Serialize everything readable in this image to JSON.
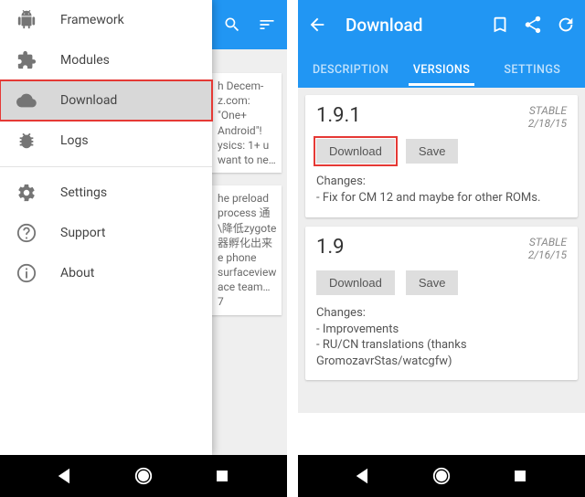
{
  "left": {
    "underlay": {
      "card1": "h Decem-\nz.com: \"One+\nAndroid\"!\nysics: 1+\nu want to\nne…",
      "card2": "he preload\n process 通\n\\降低zygote\n器孵化出来\ne phone\nsurfaceview\nace team…\n7"
    },
    "sidebar": {
      "items": [
        {
          "label": "Framework"
        },
        {
          "label": "Modules"
        },
        {
          "label": "Download"
        },
        {
          "label": "Logs"
        },
        {
          "label": "Settings"
        },
        {
          "label": "Support"
        },
        {
          "label": "About"
        }
      ]
    }
  },
  "right": {
    "appbar": {
      "title": "Download"
    },
    "tabs": [
      {
        "label": "DESCRIPTION"
      },
      {
        "label": "VERSIONS"
      },
      {
        "label": "SETTINGS"
      }
    ],
    "cards": [
      {
        "version": "1.9.1",
        "channel": "STABLE",
        "date": "2/18/15",
        "download": "Download",
        "save": "Save",
        "changes_h": "Changes:",
        "changes": "- Fix for CM 12 and maybe for other ROMs."
      },
      {
        "version": "1.9",
        "channel": "STABLE",
        "date": "2/16/15",
        "download": "Download",
        "save": "Save",
        "changes_h": "Changes:",
        "changes": "- Improvements\n- RU/CN translations (thanks GromozavrStas/watcgfw)"
      }
    ]
  }
}
